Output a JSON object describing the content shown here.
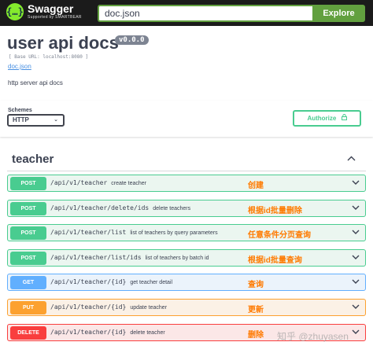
{
  "header": {
    "logo_title": "Swagger",
    "logo_sub": "Supported by SMARTBEAR",
    "url_value": "doc.json",
    "explore_label": "Explore"
  },
  "info": {
    "title": "user api docs",
    "version": "v0.0.0",
    "base_url": "[ Base URL: localhost:8080 ]",
    "doc_link": "doc.json",
    "description": "http server api docs"
  },
  "schemes": {
    "label": "Schemes",
    "selected": "HTTP",
    "authorize_label": "Authorize"
  },
  "tag": {
    "name": "teacher"
  },
  "operations": [
    {
      "method": "POST",
      "path": "/api/v1/teacher",
      "summary": "create teacher",
      "note": "创建"
    },
    {
      "method": "POST",
      "path": "/api/v1/teacher/delete/ids",
      "summary": "delete teachers",
      "note": "根据id批量删除"
    },
    {
      "method": "POST",
      "path": "/api/v1/teacher/list",
      "summary": "list of teachers by query parameters",
      "note": "任意条件分页查询"
    },
    {
      "method": "POST",
      "path": "/api/v1/teacher/list/ids",
      "summary": "list of teachers by batch id",
      "note": "根据id批量查询"
    },
    {
      "method": "GET",
      "path": "/api/v1/teacher/{id}",
      "summary": "get teacher detail",
      "note": "查询"
    },
    {
      "method": "PUT",
      "path": "/api/v1/teacher/{id}",
      "summary": "update teacher",
      "note": "更新"
    },
    {
      "method": "DELETE",
      "path": "/api/v1/teacher/{id}",
      "summary": "delete teacher",
      "note": "删除"
    }
  ],
  "watermark": "知乎 @zhuyasen",
  "colors": {
    "post": "#49cc90",
    "get": "#61affe",
    "put": "#fca130",
    "delete": "#f93e3e",
    "explore": "#62a03f",
    "note": "#ff7a00"
  }
}
